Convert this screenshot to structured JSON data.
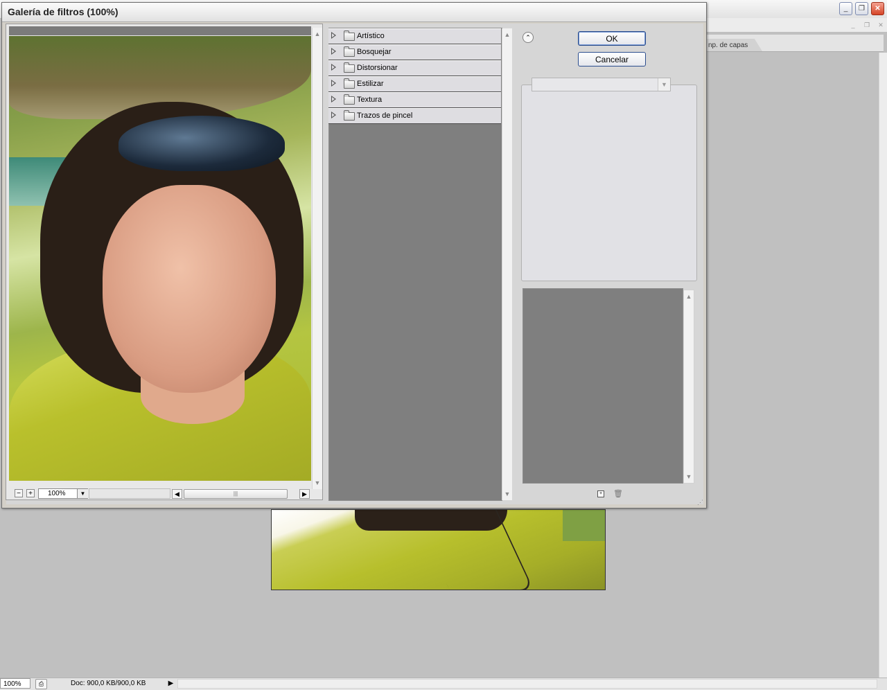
{
  "background_window": {
    "tab_label": "np. de capas",
    "controls": {
      "minimize": "_",
      "restore": "❐",
      "close": "✕"
    },
    "mini_controls": [
      "_",
      "❐",
      "✕"
    ]
  },
  "status_bar": {
    "zoom": "100%",
    "doc_info": "Doc: 900,0 KB/900,0 KB",
    "menu_arrow": "▶"
  },
  "dialog": {
    "title": "Galería de filtros (100%)",
    "preview": {
      "zoom_value": "100%",
      "zoom_minus": "−",
      "zoom_plus": "+",
      "dropdown_arrow": "▼",
      "hscroll_left": "◀",
      "hscroll_right": "▶",
      "hscroll_grip": "|||",
      "vscroll_up": "▲",
      "vscroll_down": "▼"
    },
    "filter_categories": [
      {
        "label": "Artístico"
      },
      {
        "label": "Bosquejar"
      },
      {
        "label": "Distorsionar"
      },
      {
        "label": "Estilizar"
      },
      {
        "label": "Textura"
      },
      {
        "label": "Trazos de pincel"
      }
    ],
    "filter_scroll": {
      "up": "▲",
      "down": "▼"
    },
    "collapse_glyph": "⌃",
    "buttons": {
      "ok": "OK",
      "cancel": "Cancelar"
    },
    "filter_select": {
      "value": "",
      "arrow": "▼"
    },
    "layer_scroll": {
      "up": "▲",
      "down": "▼"
    },
    "layer_actions": {
      "new": "+",
      "delete": "🗑"
    },
    "resize_grip": "⋰"
  },
  "colors": {
    "dialog_bg": "#d4d0c8",
    "panel_gray": "#7f7f7f",
    "button_border": "#274a8a",
    "close_button": "#d54426"
  }
}
